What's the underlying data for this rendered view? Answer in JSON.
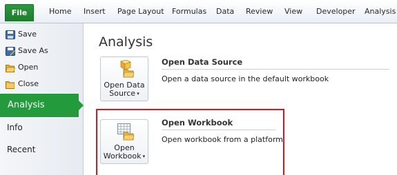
{
  "ribbon": {
    "tabs": [
      "File",
      "Home",
      "Insert",
      "Page Layout",
      "Formulas",
      "Data",
      "Review",
      "View",
      "Developer",
      "Analysis"
    ]
  },
  "sidebar": {
    "items": [
      {
        "label": "Save",
        "icon": "save-icon"
      },
      {
        "label": "Save As",
        "icon": "save-as-icon"
      },
      {
        "label": "Open",
        "icon": "open-folder-icon"
      },
      {
        "label": "Close",
        "icon": "close-folder-icon"
      }
    ],
    "active": "Analysis",
    "sections": [
      "Info",
      "Recent"
    ]
  },
  "main": {
    "title": "Analysis",
    "actions": [
      {
        "button_line1": "Open Data",
        "button_line2": "Source",
        "heading": "Open Data Source",
        "description": "Open a data source in the default workbook",
        "icon": "data-cube-icon"
      },
      {
        "button_line1": "Open",
        "button_line2": "Workbook",
        "heading": "Open Workbook",
        "description": "Open workbook from a platform",
        "icon": "workbook-grid-icon"
      }
    ]
  },
  "colors": {
    "file_tab": "#1d7c2c",
    "active_item": "#239a3b",
    "highlight_border": "#e2141b"
  }
}
